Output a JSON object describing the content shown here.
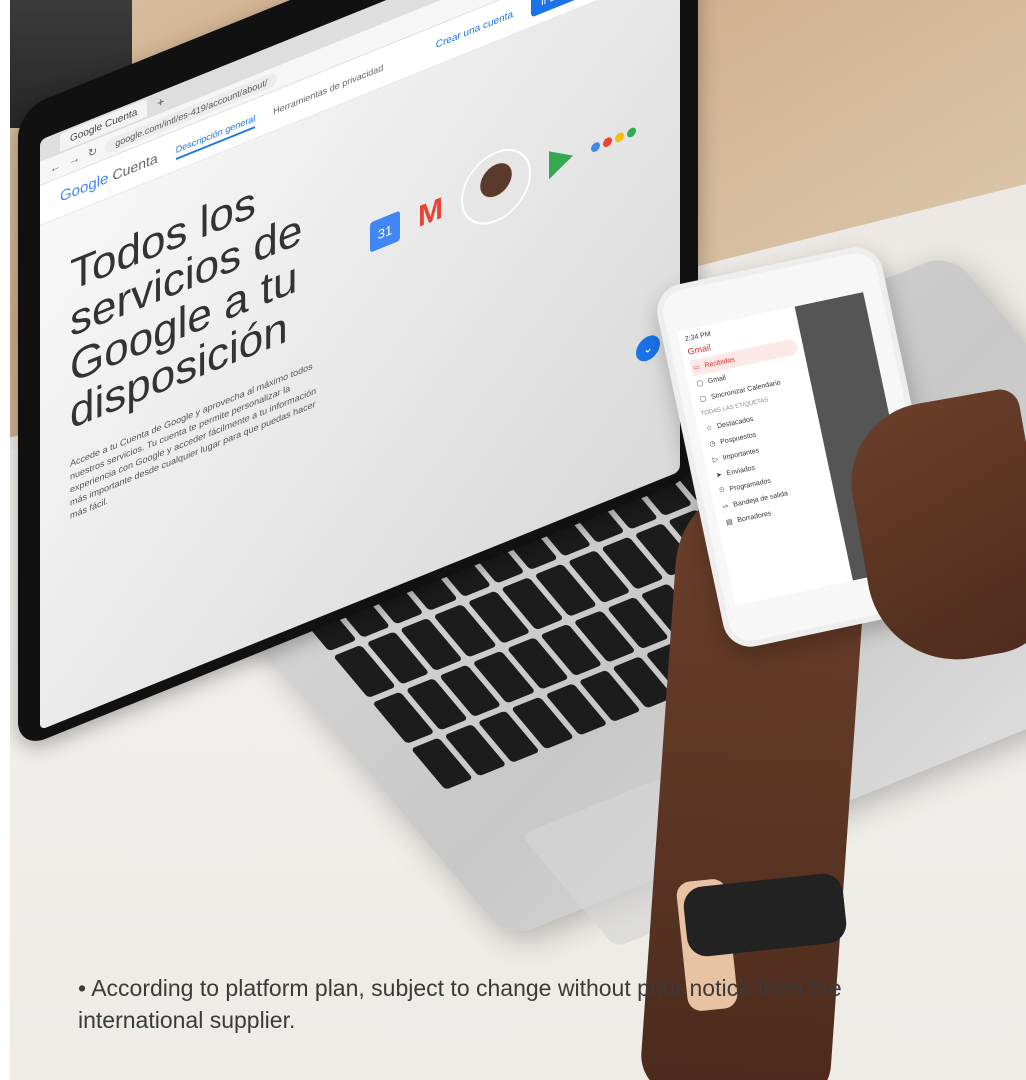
{
  "caption": {
    "bullet": "•",
    "text": "According to platform plan, subject to change without prior notice from the international supplier."
  },
  "laptop_screen": {
    "tab_title": "Google Cuenta",
    "url": "google.com/intl/es-419/account/about/",
    "logo": {
      "brand": "Google",
      "product": "Cuenta"
    },
    "tabs": [
      "Descripción general",
      "Herramientas de privacidad"
    ],
    "create_account": "Crear una cuenta",
    "go_to_account": "Ir a la Cuenta de Google",
    "hero_title": "Todos los servicios de Google a tu disposición",
    "hero_subtitle": "Accede a tu Cuenta de Google y aprovecha al máximo todos nuestros servicios. Tu cuenta te permite personalizar la experiencia con Google y acceder fácilmente a tu información más importante desde cualquier lugar para que puedas hacer más fácil.",
    "calendar_day": "31",
    "gmail_glyph": "M"
  },
  "phone_screen": {
    "time": "2:34 PM",
    "app_title": "Gmail",
    "items": [
      {
        "icon": "▭",
        "label": "Recibidos",
        "active": true
      },
      {
        "icon": "▢",
        "label": "Gmail",
        "active": false
      },
      {
        "icon": "▢",
        "label": "Sincronizar Calendario",
        "active": false
      }
    ],
    "section": "TODAS LAS ETIQUETAS",
    "labels": [
      {
        "icon": "☆",
        "label": "Destacados"
      },
      {
        "icon": "◷",
        "label": "Pospuestos"
      },
      {
        "icon": "▷",
        "label": "Importantes"
      },
      {
        "icon": "➤",
        "label": "Enviados"
      },
      {
        "icon": "⏲",
        "label": "Programados"
      },
      {
        "icon": "⇨",
        "label": "Bandeja de salida"
      },
      {
        "icon": "▤",
        "label": "Borradores"
      }
    ]
  },
  "colors": {
    "google_blue": "#1a73e8",
    "gmail_red": "#ea4335",
    "play_green": "#34a853",
    "assistant_dots": [
      "#4285f4",
      "#ea4335",
      "#fbbc05",
      "#34a853"
    ]
  }
}
